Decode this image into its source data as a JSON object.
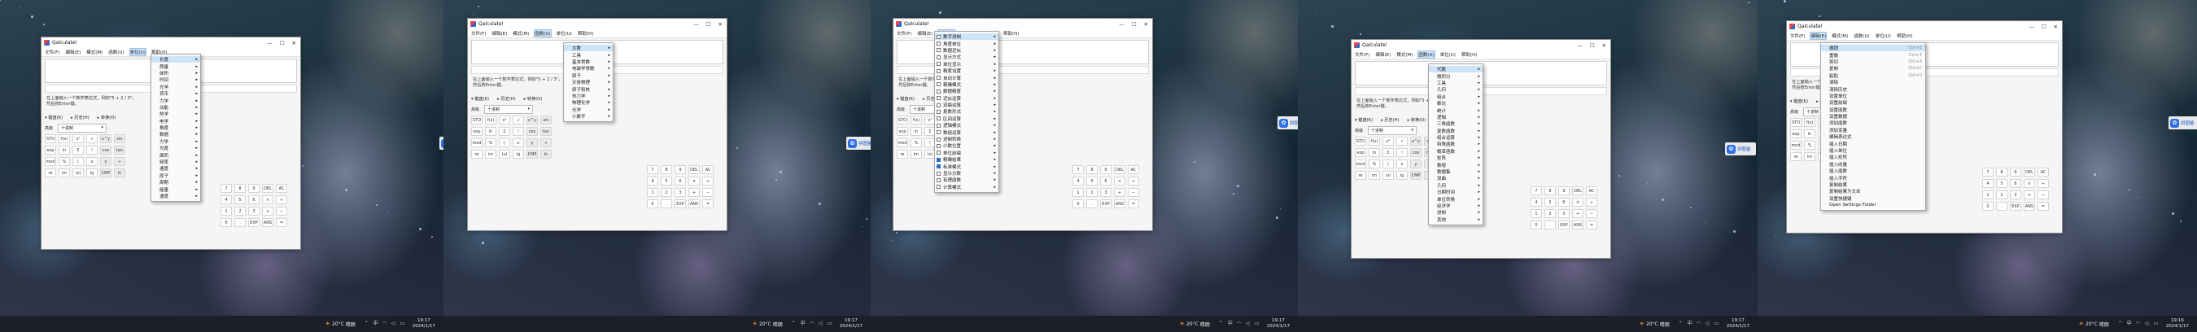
{
  "app_title": "Qalculate!",
  "window_controls": {
    "minimize": "—",
    "maximize": "☐",
    "close": "✕"
  },
  "icons": {
    "app": "qalculate-icon",
    "menu_chevron": "chevron-right-icon",
    "dropdown": "chevron-down-icon"
  },
  "colors": {
    "menu_highlight": "#cde3f8",
    "taskbar": "#1c1e26",
    "weather_sun": "#f2a23a"
  },
  "status_text": {
    "line1": "在上面输入一个数学表达式，例如\"5 + 2 / 3\"，",
    "line2": "然后按Enter键。"
  },
  "tabs": {
    "keypad": "▾ 键盘(K)",
    "history": "▸ 历史(H)",
    "conversion": "▸ 转换(O)"
  },
  "number_base": {
    "label": "十进制",
    "options_label": "高级"
  },
  "keypad": [
    [
      "STO",
      "f(x)",
      "x²",
      "√",
      "x^y",
      "sin"
    ],
    [
      "exp",
      "ln",
      "Σ",
      "!",
      "cos",
      "tan"
    ],
    [
      "mod",
      "%",
      "(",
      "x",
      "y",
      "÷"
    ],
    [
      "re",
      "im",
      "(x)",
      "lg",
      "CMP",
      "ln"
    ]
  ],
  "numpad": [
    "7",
    "8",
    "9",
    "DEL",
    "AC",
    "4",
    "5",
    "6",
    "×",
    "÷",
    "1",
    "2",
    "3",
    "+",
    "−",
    "0",
    ".",
    "EXP",
    "ANS",
    "="
  ],
  "taskbar": {
    "weather_temp": "20°C",
    "weather_desc": "晴朗",
    "time_a": "19:17",
    "date_a": "2024/1/17",
    "time_b": "19:16",
    "date_b": "2024/1/17"
  },
  "side_widget": "拼图鉴",
  "frames": [
    {
      "menubar": [
        "文件(F)",
        "编辑(E)",
        "模式(M)",
        "函数(U)",
        "单位(U)",
        "帮助(H)"
      ],
      "active": 4,
      "menu_items": [
        "长度",
        "质量",
        "体积",
        "时间",
        "光学",
        "货币",
        "力学",
        "动能",
        "热学",
        "电学",
        "角度",
        "数据",
        "力学",
        "光度",
        "面积",
        "频率",
        "速度",
        "原子",
        "周期",
        "能量",
        "速度"
      ]
    },
    {
      "menubar": [
        "文件(F)",
        "编辑(E)",
        "模式(M)",
        "函数(U)",
        "单位(U)",
        "帮助(H)"
      ],
      "active": 3,
      "menu_items": [
        "大数",
        "工具",
        "基本常数",
        "电磁学常数",
        "原子",
        "天体物理",
        "原子和核",
        "热力学",
        "物理化学",
        "光学",
        "小数字"
      ]
    },
    {
      "menubar": [
        "文件(F)",
        "编辑(E)",
        "模式(M)",
        "函数(U)",
        "单位(U)",
        "帮助(H)"
      ],
      "active": 2,
      "menu_items": [
        "数字进制",
        "角度单位",
        "数据近似",
        "显示方式",
        "单位显示",
        "精度设置",
        "自动计算",
        "精确模式",
        "数据精度",
        "近似运算",
        "双曲运算",
        "复数形式",
        "区间运算",
        "逻辑模式",
        "数组运算",
        "进制转换",
        "小数位置",
        "单位前缀",
        "精确结果",
        "标准模式",
        "显示分数",
        "有理函数",
        "计算模式"
      ],
      "checked": [
        "精确结果",
        "标准模式"
      ]
    },
    {
      "menubar": [
        "文件(F)",
        "编辑(E)",
        "模式(M)",
        "函数(U)",
        "单位(U)",
        "帮助(H)"
      ],
      "active": 3,
      "menu_items": [
        "代数",
        "微积分",
        "工具",
        "几何",
        "组合",
        "数论",
        "统计",
        "逻辑",
        "三角函数",
        "复数函数",
        "组合运算",
        "特殊函数",
        "概率函数",
        "矩阵",
        "数组",
        "数据集",
        "双曲",
        "几何",
        "日期时间",
        "单位转换",
        "经济学",
        "进制",
        "其他"
      ]
    },
    {
      "menubar": [
        "文件(F)",
        "编辑(E)",
        "模式(M)",
        "函数(U)",
        "单位(U)",
        "帮助(H)"
      ],
      "active": 1,
      "menu_items": [
        "撤销",
        "重做",
        "剪切",
        "复制",
        "粘贴",
        "清除",
        "清除历史",
        "设置单位",
        "设置前缀",
        "设置函数",
        "设置数据",
        "添加函数",
        "添加变量",
        "编辑表达式",
        "插入日期",
        "插入单位",
        "插入矩阵",
        "插入向量",
        "插入函数",
        "插入字符",
        "复制结果",
        "复制结果为文本",
        "设置快捷键",
        "Open Settings Folder"
      ],
      "shortcuts": [
        "Ctrl+Z",
        "Ctrl+Y",
        "Ctrl+X",
        "Ctrl+C",
        "Ctrl+V"
      ]
    }
  ]
}
